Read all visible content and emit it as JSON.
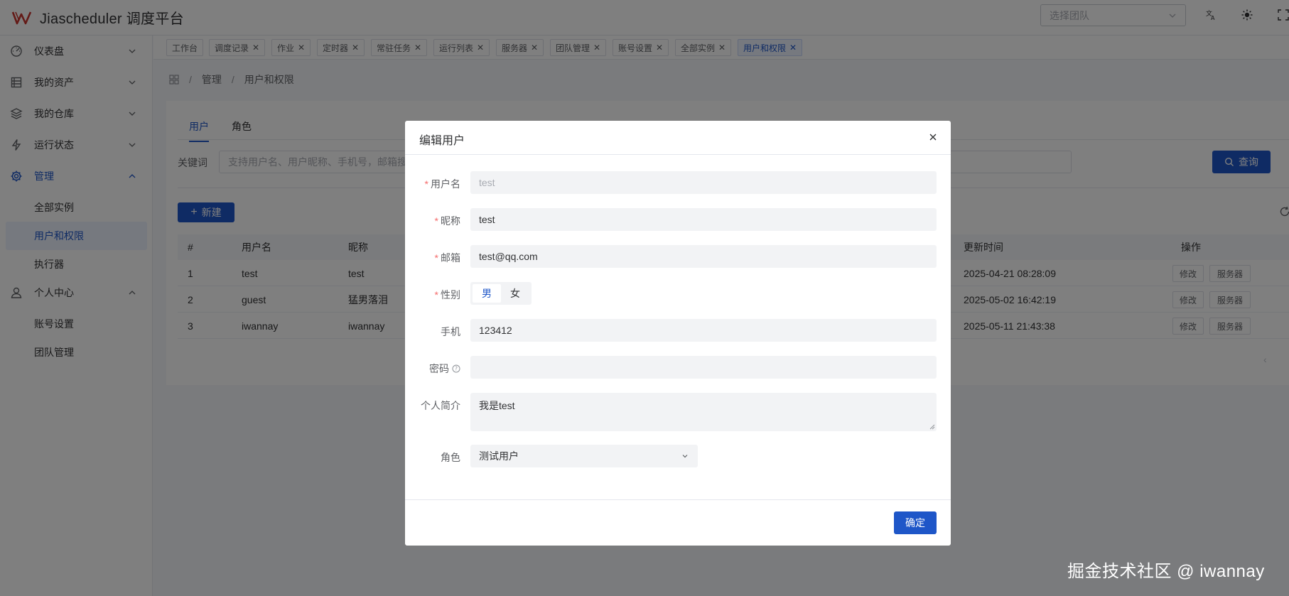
{
  "header": {
    "app_title": "Jiascheduler 调度平台",
    "team_select_placeholder": "选择团队",
    "icons": [
      "translate-icon",
      "theme-toggle-icon",
      "fullscreen-icon"
    ]
  },
  "sidebar": {
    "items": [
      {
        "label": "仪表盘",
        "icon": "dashboard-icon"
      },
      {
        "label": "我的资产",
        "icon": "assets-icon"
      },
      {
        "label": "我的仓库",
        "icon": "repository-icon"
      },
      {
        "label": "运行状态",
        "icon": "lightning-icon"
      },
      {
        "label": "管理",
        "icon": "gear-icon",
        "expanded": true
      },
      {
        "label": "个人中心",
        "icon": "user-icon",
        "expanded": true
      }
    ],
    "manage_children": [
      "全部实例",
      "用户和权限",
      "执行器"
    ],
    "personal_children": [
      "账号设置",
      "团队管理"
    ],
    "selected": "用户和权限"
  },
  "tabs": [
    {
      "label": "工作台",
      "closable": false
    },
    {
      "label": "调度记录",
      "closable": true
    },
    {
      "label": "作业",
      "closable": true
    },
    {
      "label": "定时器",
      "closable": true
    },
    {
      "label": "常驻任务",
      "closable": true
    },
    {
      "label": "运行列表",
      "closable": true
    },
    {
      "label": "服务器",
      "closable": true
    },
    {
      "label": "团队管理",
      "closable": true
    },
    {
      "label": "账号设置",
      "closable": true
    },
    {
      "label": "全部实例",
      "closable": true
    },
    {
      "label": "用户和权限",
      "closable": true,
      "active": true
    }
  ],
  "breadcrumb": [
    "管理",
    "用户和权限"
  ],
  "inner_tabs": [
    "用户",
    "角色"
  ],
  "search": {
    "label": "关键词",
    "placeholder": "支持用户名、用户昵称、手机号，邮箱搜",
    "query_button": "查询"
  },
  "new_button": "新建",
  "table": {
    "columns": [
      "#",
      "用户名",
      "昵称",
      "更新时间",
      "操作"
    ],
    "rows": [
      {
        "index": "1",
        "username": "test",
        "nickname": "test",
        "updated": "2025-04-21 08:28:09"
      },
      {
        "index": "2",
        "username": "guest",
        "nickname": "猛男落泪",
        "updated": "2025-05-02 16:42:19"
      },
      {
        "index": "3",
        "username": "iwannay",
        "nickname": "iwannay",
        "updated": "2025-05-11 21:43:38"
      }
    ],
    "edit_label": "修改",
    "server_label": "服务器"
  },
  "modal": {
    "title": "编辑用户",
    "fields": {
      "username": {
        "label": "用户名",
        "value": "test",
        "required": true,
        "disabled": true
      },
      "nickname": {
        "label": "昵称",
        "value": "test",
        "required": true
      },
      "email": {
        "label": "邮箱",
        "value": "test@qq.com",
        "required": true
      },
      "gender": {
        "label": "性别",
        "options": [
          "男",
          "女"
        ],
        "selected": "男",
        "required": true
      },
      "phone": {
        "label": "手机",
        "value": "123412"
      },
      "password": {
        "label": "密码",
        "value": ""
      },
      "bio": {
        "label": "个人简介",
        "value": "我是test"
      },
      "role": {
        "label": "角色",
        "value": "测试用户"
      }
    },
    "confirm_button": "确定"
  },
  "watermark": "掘金技术社区 @ iwannay",
  "colors": {
    "accent": "#1e56c8",
    "required": "#f56c6c"
  }
}
